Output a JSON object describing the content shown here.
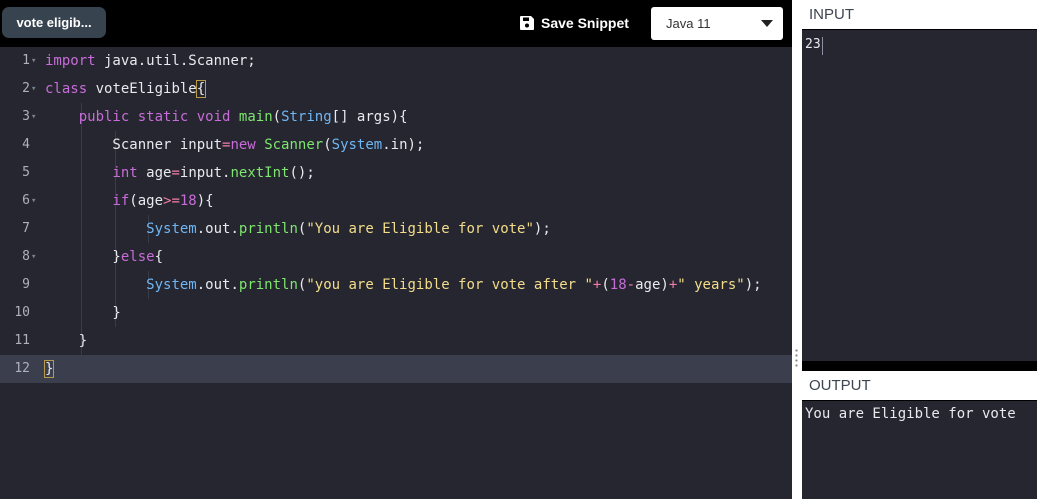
{
  "toolbar": {
    "file_tab": "vote eligib...",
    "save_label": "Save Snippet",
    "language": "Java 11"
  },
  "editor": {
    "active_line": 12,
    "lines": [
      {
        "no": "1",
        "html": "<span class=\"k\">import</span> java.util.Scanner;"
      },
      {
        "no": "2",
        "html": "<span class=\"k\">class</span> voteEligible<span class=\"bracket-hl\">{</span>"
      },
      {
        "no": "3",
        "html": "    <span class=\"k\">public</span> <span class=\"k\">static</span> <span class=\"k\">void</span> <span class=\"g\">main</span>(<span class=\"f\">String</span>[] args){"
      },
      {
        "no": "4",
        "html": "        Scanner input<span class=\"o\">=</span><span class=\"k\">new</span> <span class=\"g\">Scanner</span>(<span class=\"f\">System</span>.in);"
      },
      {
        "no": "5",
        "html": "        <span class=\"k\">int</span> age<span class=\"o\">=</span>input.<span class=\"g\">nextInt</span>();"
      },
      {
        "no": "6",
        "html": "        <span class=\"k\">if</span>(age<span class=\"o\">&gt;=</span><span class=\"n\">18</span>){"
      },
      {
        "no": "7",
        "html": "            <span class=\"f\">System</span>.out.<span class=\"g\">println</span>(<span class=\"s\">\"You are Eligible for vote\"</span>);"
      },
      {
        "no": "8",
        "html": "        }<span class=\"k\">else</span>{"
      },
      {
        "no": "9",
        "html": "            <span class=\"f\">System</span>.out.<span class=\"g\">println</span>(<span class=\"s\">\"you are Eligible for vote after \"</span><span class=\"o\">+</span>(<span class=\"n\">18</span><span class=\"o\">-</span>age)<span class=\"o\">+</span><span class=\"s\">\" years\"</span>);"
      },
      {
        "no": "10",
        "html": "        }"
      },
      {
        "no": "11",
        "html": "    }"
      },
      {
        "no": "12",
        "html": "<span class=\"bracket-hl\">}</span>"
      }
    ],
    "foldable": [
      "1",
      "2",
      "3",
      "6",
      "8"
    ]
  },
  "input_panel": {
    "title": "INPUT",
    "value": "23"
  },
  "output_panel": {
    "title": "OUTPUT",
    "value": "You are Eligible for vote"
  },
  "icons": {
    "save": "floppy-disk-icon",
    "dropdown": "chevron-down-icon"
  }
}
